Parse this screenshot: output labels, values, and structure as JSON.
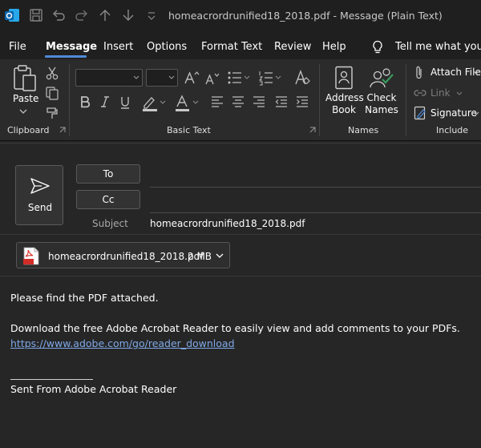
{
  "window": {
    "title": "homeacrordrunified18_2018.pdf  -  Message (Plain Text)"
  },
  "menu": {
    "items": [
      "File",
      "Message",
      "Insert",
      "Options",
      "Format Text",
      "Review",
      "Help"
    ],
    "active": "Message",
    "tell_me": "Tell me what you w"
  },
  "ribbon": {
    "clipboard": {
      "paste": "Paste",
      "group": "Clipboard"
    },
    "basic_text": {
      "group": "Basic Text"
    },
    "names": {
      "address_book": [
        "Address",
        "Book"
      ],
      "check_names": [
        "Check",
        "Names"
      ],
      "group": "Names"
    },
    "include": {
      "attach_file": "Attach File",
      "link": "Link",
      "signature": "Signature",
      "group": "Include"
    }
  },
  "compose": {
    "send": "Send",
    "to": "To",
    "cc": "Cc",
    "subject_label": "Subject",
    "subject_value": "homeacrordrunified18_2018.pdf"
  },
  "attachment": {
    "name": "homeacrordrunified18_2018.pdf",
    "size": "2 MB"
  },
  "body": {
    "line1": "Please find the PDF attached.",
    "line2": "Download the free Adobe Acrobat Reader to easily view and add comments to your PDFs.",
    "link": "https://www.adobe.com/go/reader_download",
    "signature": "Sent From Adobe Acrobat Reader"
  },
  "colors": {
    "background": "#262626",
    "titlebar": "#1f1f1f",
    "ribbon": "#2b2b2b",
    "accent": "#4f8ad6",
    "link": "#7ea8e6",
    "pdf_red": "#d32d27"
  }
}
